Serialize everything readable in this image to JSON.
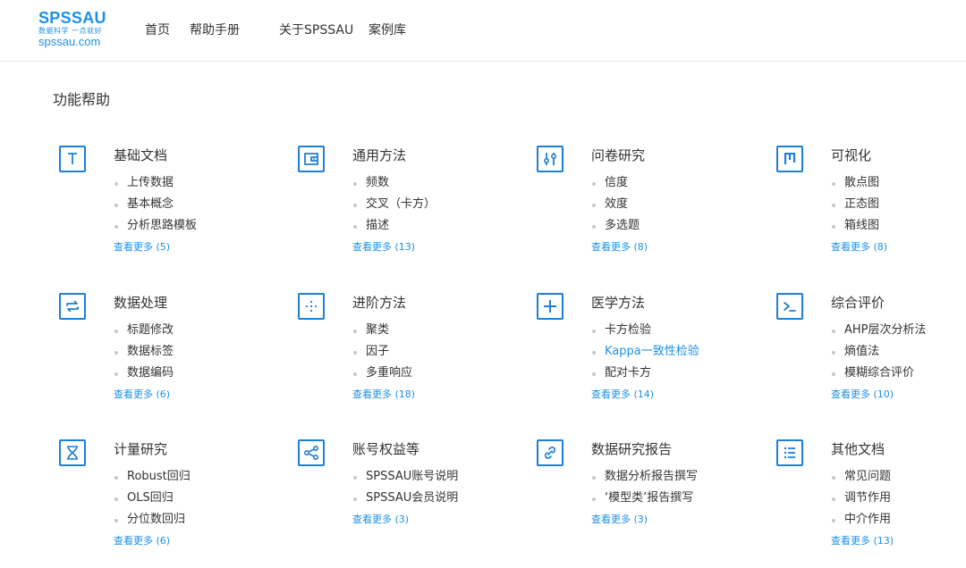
{
  "header": {
    "logo": {
      "main": "SPSSAU",
      "tagline": "数据科学 一点就好",
      "url": "spssau.com"
    },
    "nav": [
      "首页",
      "帮助手册",
      "关于SPSSAU",
      "案例库"
    ]
  },
  "section_title": "功能帮助",
  "colors": {
    "accent": "#1e90e6",
    "icon_border": "#1e7fd4",
    "bullet": "#c7c7c7",
    "text": "#333333"
  },
  "categories": [
    {
      "title": "基础文档",
      "icon": "text-t-icon",
      "items": [
        "上传数据",
        "基本概念",
        "分析思路模板"
      ],
      "more": "查看更多 (5)"
    },
    {
      "title": "通用方法",
      "icon": "wallet-icon",
      "items": [
        "频数",
        "交叉（卡方）",
        "描述"
      ],
      "more": "查看更多 (13)"
    },
    {
      "title": "问卷研究",
      "icon": "sliders-icon",
      "items": [
        "信度",
        "效度",
        "多选题"
      ],
      "more": "查看更多 (8)"
    },
    {
      "title": "可视化",
      "icon": "bar-chart-icon",
      "items": [
        "散点图",
        "正态图",
        "箱线图"
      ],
      "more": "查看更多 (8)"
    },
    {
      "title": "数据处理",
      "icon": "repeat-icon",
      "items": [
        "标题修改",
        "数据标签",
        "数据编码"
      ],
      "more": "查看更多 (6)"
    },
    {
      "title": "进阶方法",
      "icon": "dots-grid-icon",
      "items": [
        "聚类",
        "因子",
        "多重响应"
      ],
      "more": "查看更多 (18)"
    },
    {
      "title": "医学方法",
      "icon": "plus-icon",
      "items": [
        "卡方检验",
        "Kappa一致性检验",
        "配对卡方"
      ],
      "highlight": 1,
      "more": "查看更多 (14)"
    },
    {
      "title": "综合评价",
      "icon": "terminal-icon",
      "items": [
        "AHP层次分析法",
        "熵值法",
        "模糊综合评价"
      ],
      "more": "查看更多 (10)"
    },
    {
      "title": "计量研究",
      "icon": "hourglass-icon",
      "items": [
        "Robust回归",
        "OLS回归",
        "分位数回归"
      ],
      "more": "查看更多 (6)"
    },
    {
      "title": "账号权益等",
      "icon": "share-icon",
      "items": [
        "SPSSAU账号说明",
        "SPSSAU会员说明"
      ],
      "more": "查看更多 (3)"
    },
    {
      "title": "数据研究报告",
      "icon": "link-icon",
      "items": [
        "数据分析报告撰写",
        "‘模型类’报告撰写"
      ],
      "more": "查看更多 (3)"
    },
    {
      "title": "其他文档",
      "icon": "list-icon",
      "items": [
        "常见问题",
        "调节作用",
        "中介作用"
      ],
      "more": "查看更多 (13)"
    }
  ]
}
